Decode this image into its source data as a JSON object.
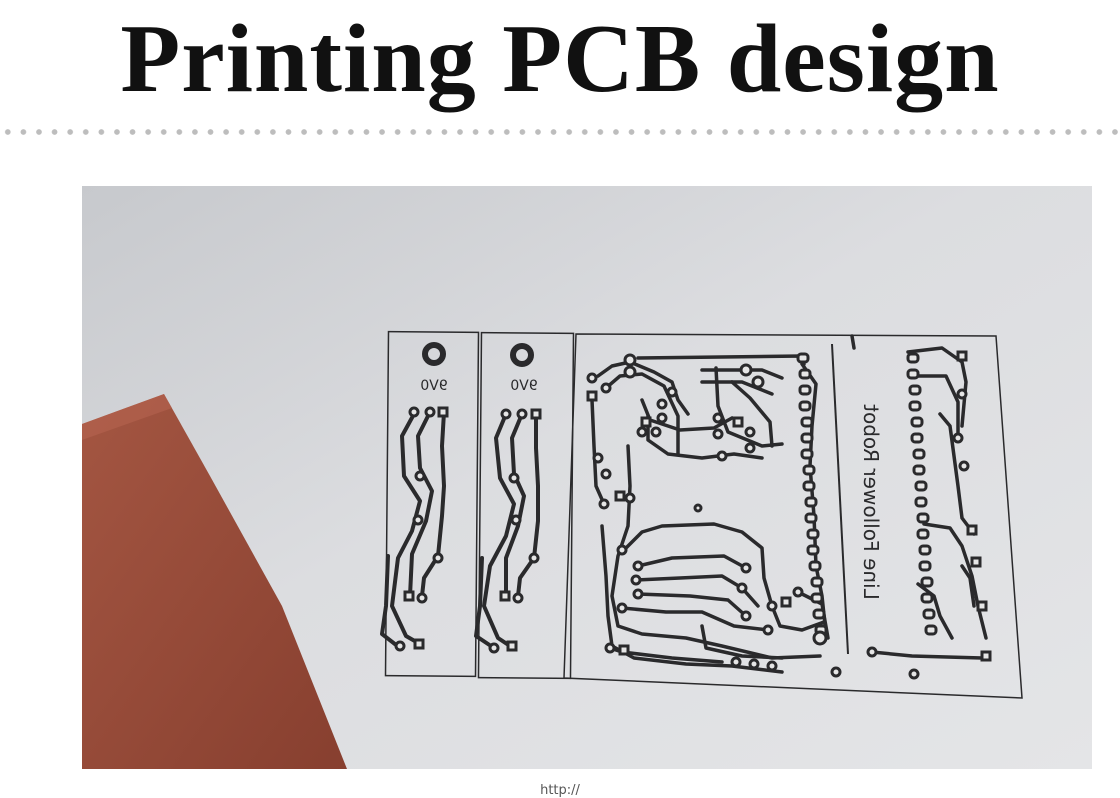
{
  "slide": {
    "title": "Printing PCB design",
    "caption": "http://"
  },
  "pcb": {
    "board_text": "Line Follower Robot",
    "module_label_left": "9V0",
    "module_label_right": "9V0"
  },
  "colors": {
    "title": "#111111",
    "divider_dots": "#bdbdbd",
    "paper": "#d9dadd",
    "copper_board": "#9a4b38",
    "trace": "#2a2a2c"
  }
}
